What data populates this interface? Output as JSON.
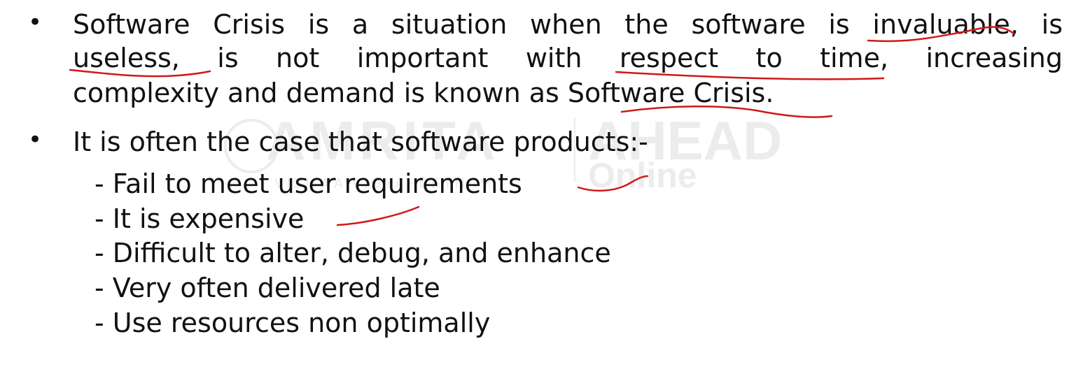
{
  "watermark": {
    "brand": "AMRITA",
    "subtitle": "VISHWA VIDYAPEETHAM",
    "ahead": "AHEAD",
    "online": "Online"
  },
  "bullets": [
    {
      "symbol": "•",
      "lines": [
        "Software Crisis is a situation when the software is invaluable, is",
        "useless, is not important with respect to time, increasing",
        "complexity and demand is known as Software Crisis."
      ]
    },
    {
      "symbol": "•",
      "lines": [
        "It is often the case that software products:-"
      ],
      "subitems": [
        "- Fail to meet user requirements",
        "- It is expensive",
        "- Difficult to alter, debug, and enhance",
        "- Very often delivered late",
        "- Use resources non optimally"
      ]
    }
  ],
  "annotation_color": "#d01818"
}
